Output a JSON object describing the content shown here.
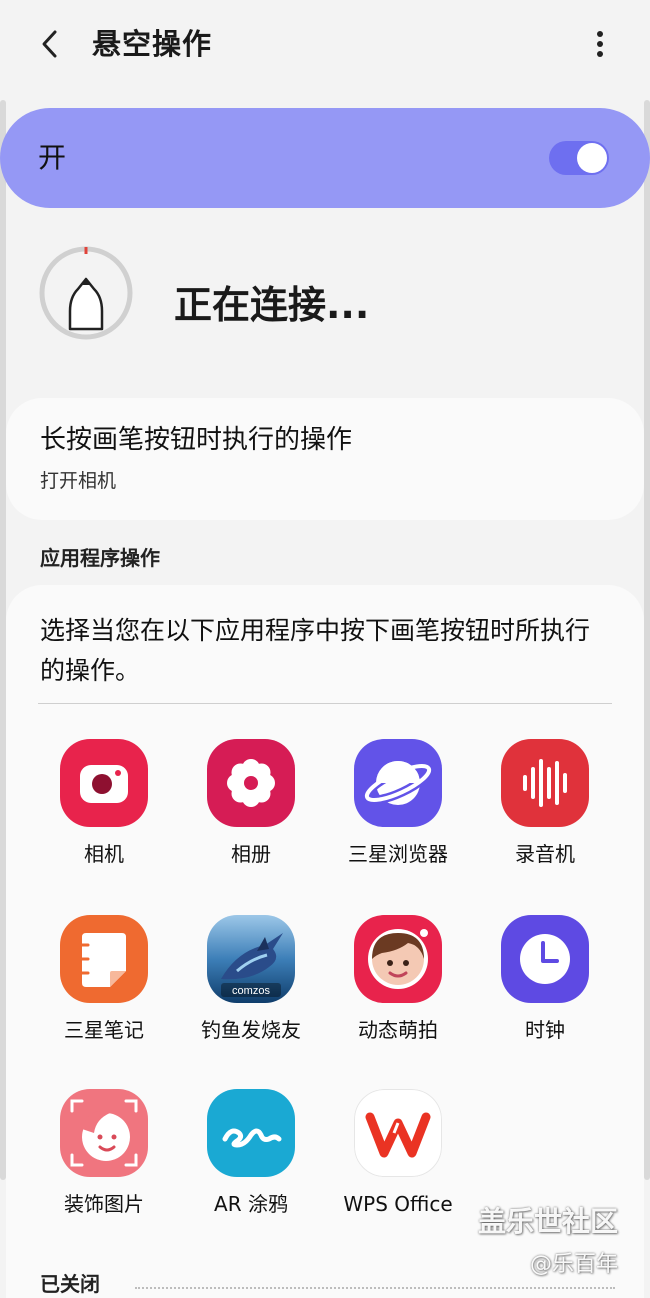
{
  "header": {
    "title": "悬空操作"
  },
  "master_switch": {
    "label": "开",
    "state": "on",
    "accent_color": "#9598f5"
  },
  "pen_status": {
    "text": "正在连接..."
  },
  "long_press": {
    "title": "长按画笔按钮时执行的操作",
    "value": "打开相机"
  },
  "app_actions": {
    "section_title": "应用程序操作",
    "description": "选择当您在以下应用程序中按下画笔按钮时所执行的操作。",
    "apps": [
      {
        "label": "相机",
        "icon": "camera-icon"
      },
      {
        "label": "相册",
        "icon": "gallery-icon"
      },
      {
        "label": "三星浏览器",
        "icon": "browser-icon"
      },
      {
        "label": "录音机",
        "icon": "voice-recorder-icon"
      },
      {
        "label": "三星笔记",
        "icon": "notes-icon"
      },
      {
        "label": "钓鱼发烧友",
        "icon": "fishing-game-icon"
      },
      {
        "label": "动态萌拍",
        "icon": "ar-emoji-icon"
      },
      {
        "label": "时钟",
        "icon": "clock-icon"
      },
      {
        "label": "装饰图片",
        "icon": "decorate-pic-icon"
      },
      {
        "label": "AR 涂鸦",
        "icon": "ar-doodle-icon"
      },
      {
        "label": "WPS Office",
        "icon": "wps-office-icon"
      }
    ]
  },
  "closed_section": {
    "title": "已关闭"
  },
  "watermark": {
    "line1": "盖乐世社区",
    "line2": "@乐百年"
  }
}
